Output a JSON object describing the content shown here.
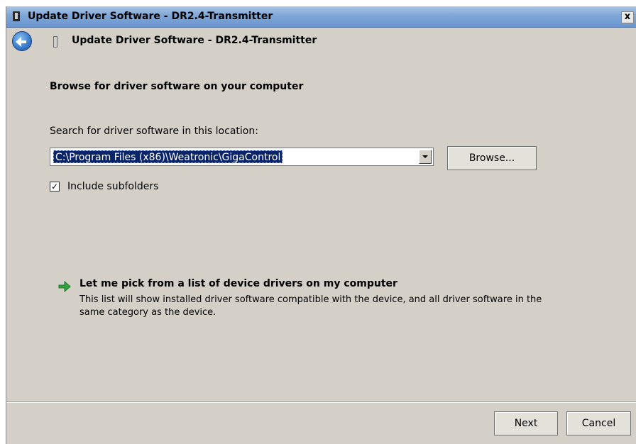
{
  "window": {
    "title": "Update Driver Software - DR2.4-Transmitter",
    "close_label": "x"
  },
  "nav": {
    "title": "Update Driver Software - DR2.4-Transmitter"
  },
  "main": {
    "heading": "Browse for driver software on your computer",
    "search_label": "Search for driver software in this location:",
    "path_value": "C:\\Program Files (x86)\\Weatronic\\GigaControl",
    "browse_label": "Browse...",
    "include_subfolders": {
      "label": "Include subfolders",
      "checked": true,
      "check_glyph": "✓"
    },
    "pick_option": {
      "title": "Let me pick from a list of device drivers on my computer",
      "description": "This list will show installed driver software compatible with the device, and all driver software in the same category as the device."
    }
  },
  "footer": {
    "next_label": "Next",
    "cancel_label": "Cancel"
  },
  "icons": {
    "back": "back-arrow-icon",
    "device": "device-icon",
    "pick_arrow": "green-arrow-icon"
  },
  "colors": {
    "titlebar": "#7fa6d6",
    "dialog_bg": "#d4d0c8",
    "selection": "#0a246a",
    "arrow_green": "#2fa33a"
  }
}
